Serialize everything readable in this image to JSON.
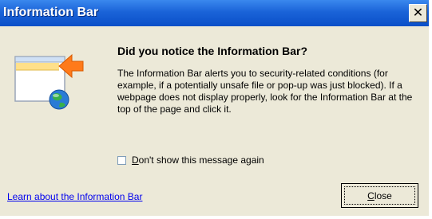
{
  "window": {
    "title": "Information Bar",
    "close_glyph": "✕"
  },
  "main": {
    "heading": "Did you notice the Information Bar?",
    "body": "The Information Bar alerts you to security-related conditions (for example, if a potentially unsafe file or pop-up was just blocked). If a webpage does not display properly, look for the Information Bar at the top of the page and click it."
  },
  "checkbox": {
    "label_underlined": "D",
    "label_rest": "on't show this message again",
    "checked": false
  },
  "footer": {
    "link": "Learn about the Information Bar",
    "close_label": "Close"
  },
  "colors": {
    "titlebar": "#0a4fc8",
    "dialog_bg": "#ece9d8",
    "link": "#0000ee",
    "arrow": "#ff7a1a"
  },
  "icons": {
    "illustration": "information-bar-illustration-icon",
    "globe": "globe-icon",
    "arrow": "arrow-icon"
  }
}
